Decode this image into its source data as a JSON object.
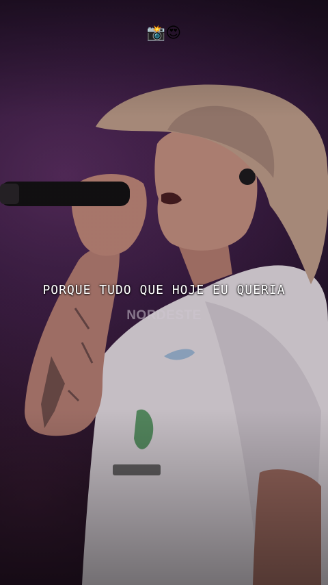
{
  "overlay": {
    "emoji": "📸😍",
    "lyric": "PORQUE TUDO QUE HOJE EU QUERIA"
  },
  "watermark": {
    "text": "NORDESTE"
  },
  "colors": {
    "background": "#3b1d44",
    "shirt": "#ebe4ea",
    "hat": "#c9a894",
    "skin": "#c98f80"
  }
}
